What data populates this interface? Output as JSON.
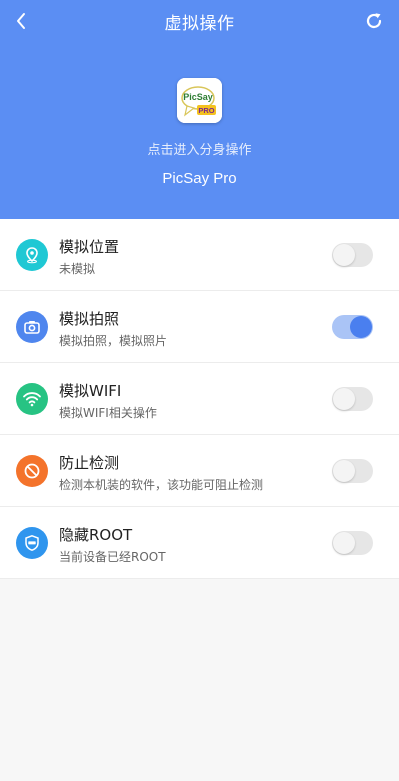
{
  "header": {
    "title": "虚拟操作",
    "clone_hint": "点击进入分身操作",
    "app_name": "PicSay Pro",
    "app_icon_text_top": "PicSay",
    "app_icon_text_bottom": "PRO",
    "back_icon": "chevron-left-icon",
    "refresh_icon": "refresh-icon",
    "background_color": "#5b8ef3"
  },
  "settings": [
    {
      "title": "模拟位置",
      "subtitle": "未模拟",
      "icon": "location-pin-icon",
      "icon_color": "#1fc8d4",
      "enabled": false
    },
    {
      "title": "模拟拍照",
      "subtitle": "模拟拍照，模拟照片",
      "icon": "camera-icon",
      "icon_color": "#4f86ee",
      "enabled": true
    },
    {
      "title": "模拟WIFI",
      "subtitle": "模拟WIFI相关操作",
      "icon": "wifi-icon",
      "icon_color": "#27c383",
      "enabled": false
    },
    {
      "title": "防止检测",
      "subtitle": "检测本机装的软件，该功能可阻止检测",
      "icon": "block-icon",
      "icon_color": "#f4732b",
      "enabled": false
    },
    {
      "title": "隐藏ROOT",
      "subtitle": "当前设备已经ROOT",
      "icon": "shield-icon",
      "icon_color": "#2f95ee",
      "enabled": false
    }
  ]
}
